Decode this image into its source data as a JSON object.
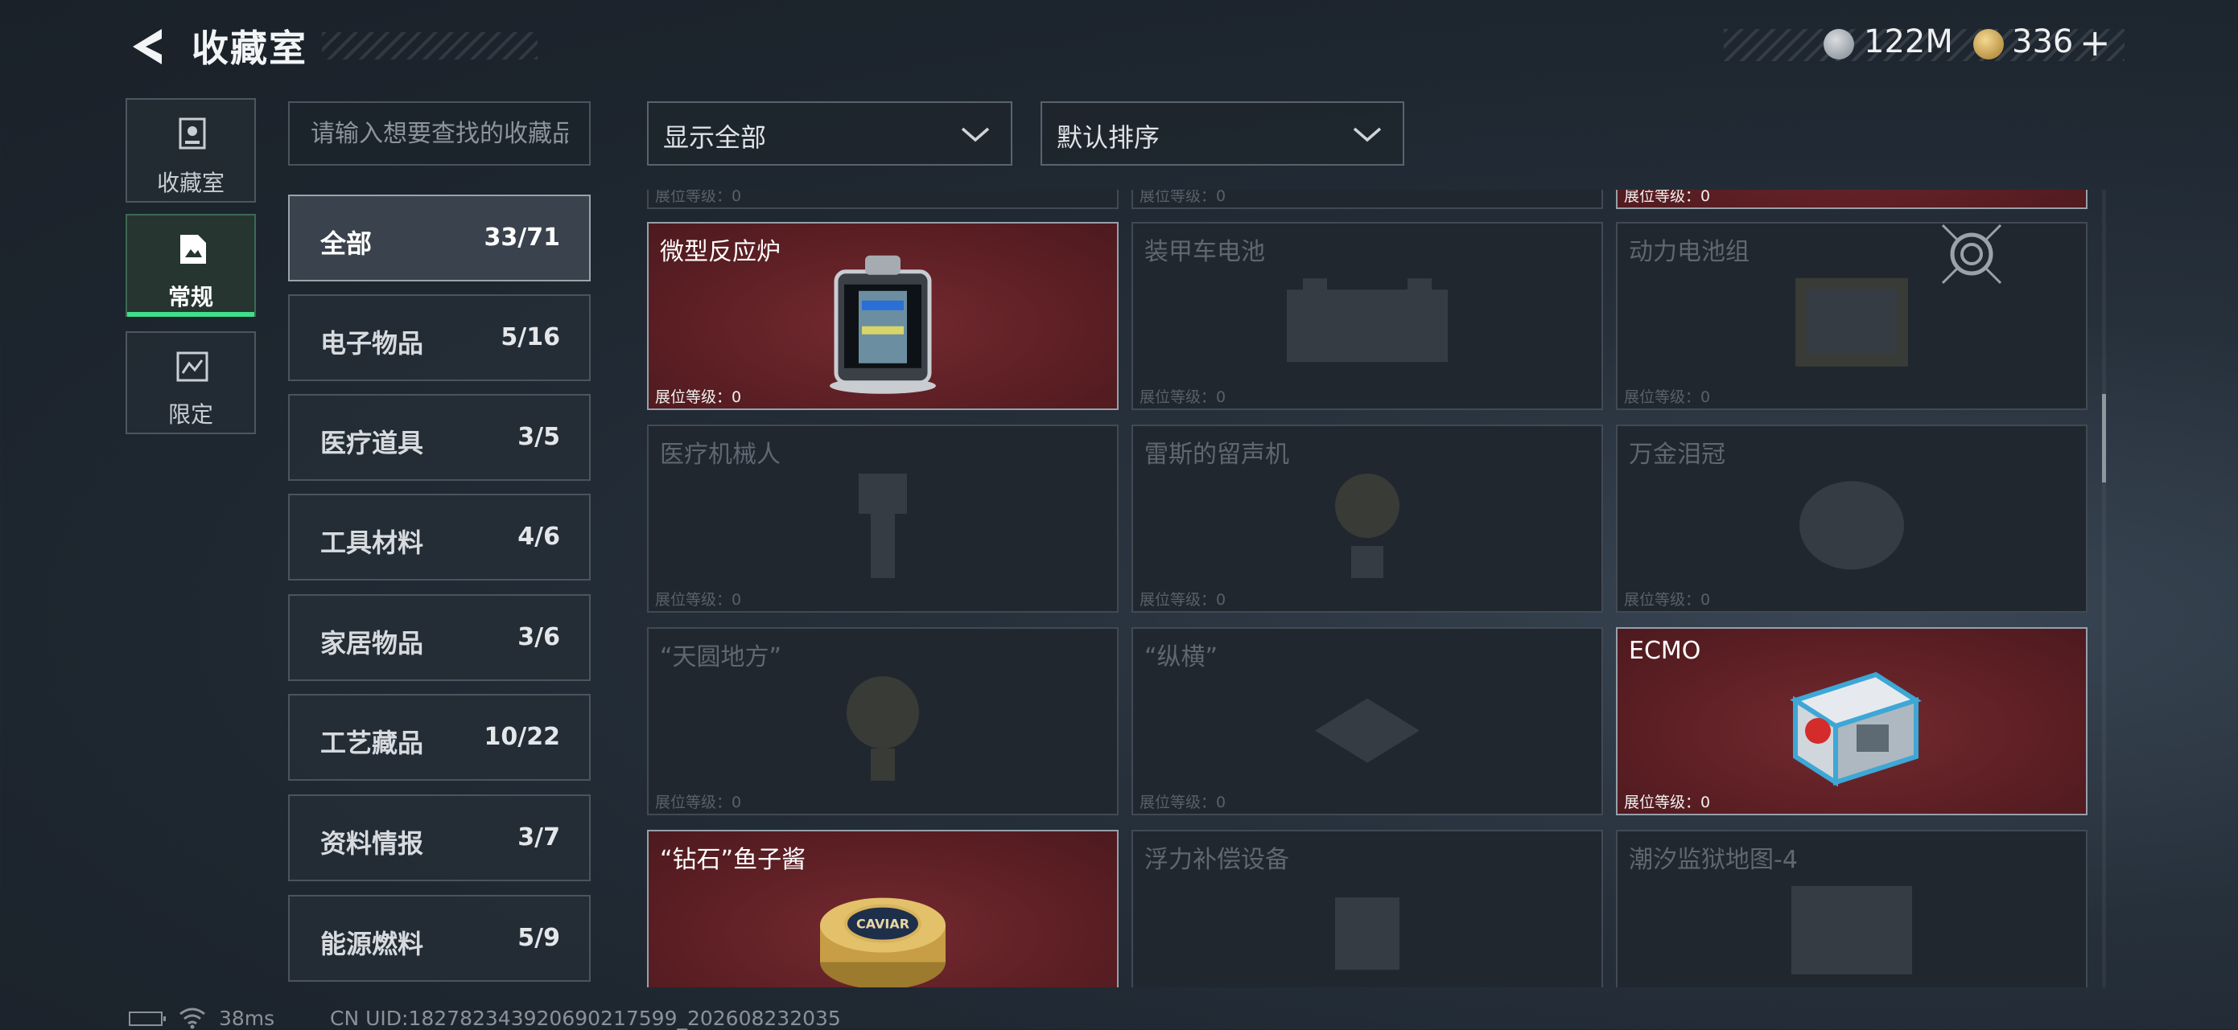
{
  "header": {
    "title": "收藏室",
    "currency_1": "122M",
    "currency_2": "336",
    "plus_label": "+"
  },
  "nav_tabs": [
    {
      "label": "收藏室",
      "icon": "collection-icon"
    },
    {
      "label": "常规",
      "icon": "document-icon",
      "active": true
    },
    {
      "label": "限定",
      "icon": "limited-icon"
    }
  ],
  "search": {
    "placeholder": "请输入想要查找的收藏品"
  },
  "filters": {
    "display": "显示全部",
    "sort": "默认排序"
  },
  "categories": [
    {
      "name": "全部",
      "count": "33/71",
      "active": true
    },
    {
      "name": "电子物品",
      "count": "5/16"
    },
    {
      "name": "医疗道具",
      "count": "3/5"
    },
    {
      "name": "工具材料",
      "count": "4/6"
    },
    {
      "name": "家居物品",
      "count": "3/6"
    },
    {
      "name": "工艺藏品",
      "count": "10/22"
    },
    {
      "name": "资料情报",
      "count": "3/7"
    },
    {
      "name": "能源燃料",
      "count": "5/9"
    }
  ],
  "level_label": "展位等级：",
  "level_value": "0",
  "items": [
    {
      "name": "微型反应炉",
      "owned": true,
      "icon": "reactor-icon"
    },
    {
      "name": "装甲车电池",
      "owned": false,
      "icon": "battery-icon"
    },
    {
      "name": "动力电池组",
      "owned": false,
      "icon": "battery-pack-icon"
    },
    {
      "name": "医疗机械人",
      "owned": false,
      "icon": "robot-icon"
    },
    {
      "name": "雷斯的留声机",
      "owned": false,
      "icon": "phonograph-icon"
    },
    {
      "name": "万金泪冠",
      "owned": false,
      "icon": "crown-icon"
    },
    {
      "name": "“天圆地方”",
      "owned": false,
      "icon": "globe-icon"
    },
    {
      "name": "“纵横”",
      "owned": false,
      "icon": "chessboard-icon"
    },
    {
      "name": "ECMO",
      "owned": true,
      "icon": "ecmo-machine-icon"
    },
    {
      "name": "“钻石”鱼子酱",
      "owned": true,
      "icon": "caviar-tin-icon",
      "tin_text": "CAVIAR"
    },
    {
      "name": "浮力补偿设备",
      "owned": false,
      "icon": "buoyancy-device-icon"
    },
    {
      "name": "潮汐监狱地图-4",
      "owned": false,
      "icon": "map-icon"
    }
  ],
  "status": {
    "ping": "38ms",
    "uid": "CN UID:1827823439206902175​99_202608232035"
  }
}
